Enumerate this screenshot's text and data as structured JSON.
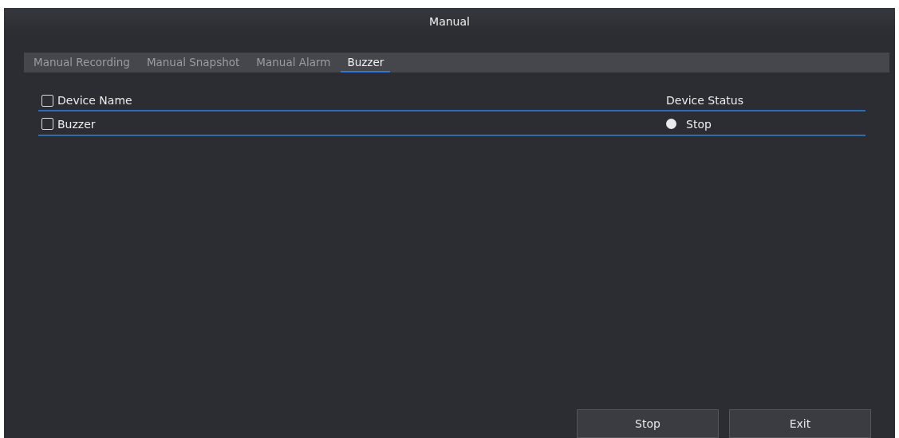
{
  "window": {
    "title": "Manual"
  },
  "tabs": [
    {
      "label": "Manual Recording",
      "selected": false
    },
    {
      "label": "Manual Snapshot",
      "selected": false
    },
    {
      "label": "Manual Alarm",
      "selected": false
    },
    {
      "label": "Buzzer",
      "selected": true
    }
  ],
  "table": {
    "columns": [
      {
        "label": "Device Name",
        "checked": false
      },
      {
        "label": "Device Status"
      }
    ],
    "rows": [
      {
        "name": "Buzzer",
        "checked": false,
        "status": "Stop",
        "running": false
      }
    ]
  },
  "buttons": [
    "Stop",
    "Exit"
  ]
}
